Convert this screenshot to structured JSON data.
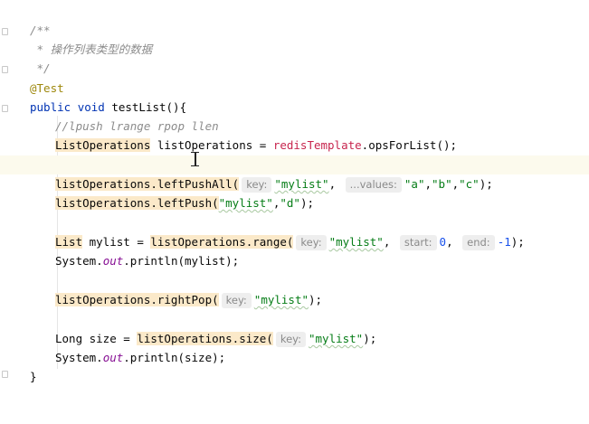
{
  "editor": {
    "lines": {
      "c1": "/**",
      "c2_star": " * ",
      "c2_text": "操作列表类型的数据",
      "c3": " */",
      "annotation": "@Test",
      "public": "public",
      "void": "void",
      "method_sig": "testList(){",
      "comment_cmds": "//lpush lrange rpop llen",
      "list_ops_type": "ListOperations",
      "list_ops_var": " listOperations = ",
      "redis_template": "redisTemplate",
      "ops_for_list": ".opsForList();",
      "leftpushall": "listOperations.leftPushAll(",
      "hint_key": "key:",
      "mylist": "\"mylist\"",
      "comma": ",",
      "hint_values": "...values:",
      "str_a": "\"a\"",
      "str_b": "\"b\"",
      "str_c": "\"c\"",
      "close_paren_semi": ");",
      "leftpush": "listOperations.leftPush(",
      "str_d": "\"d\"",
      "list_type": "List",
      "mylist_var": " mylist = ",
      "range_call": "listOperations.range(",
      "hint_start": "start:",
      "zero": "0",
      "hint_end": "end:",
      "minus_one": "-1",
      "sysout_pre": "System.",
      "out": "out",
      "println_mylist": ".println(mylist);",
      "rightpop": "listOperations.rightPop(",
      "long_size": "Long size = ",
      "size_call": "listOperations.size(",
      "println_size": ".println(size);",
      "close_brace": "}"
    }
  }
}
